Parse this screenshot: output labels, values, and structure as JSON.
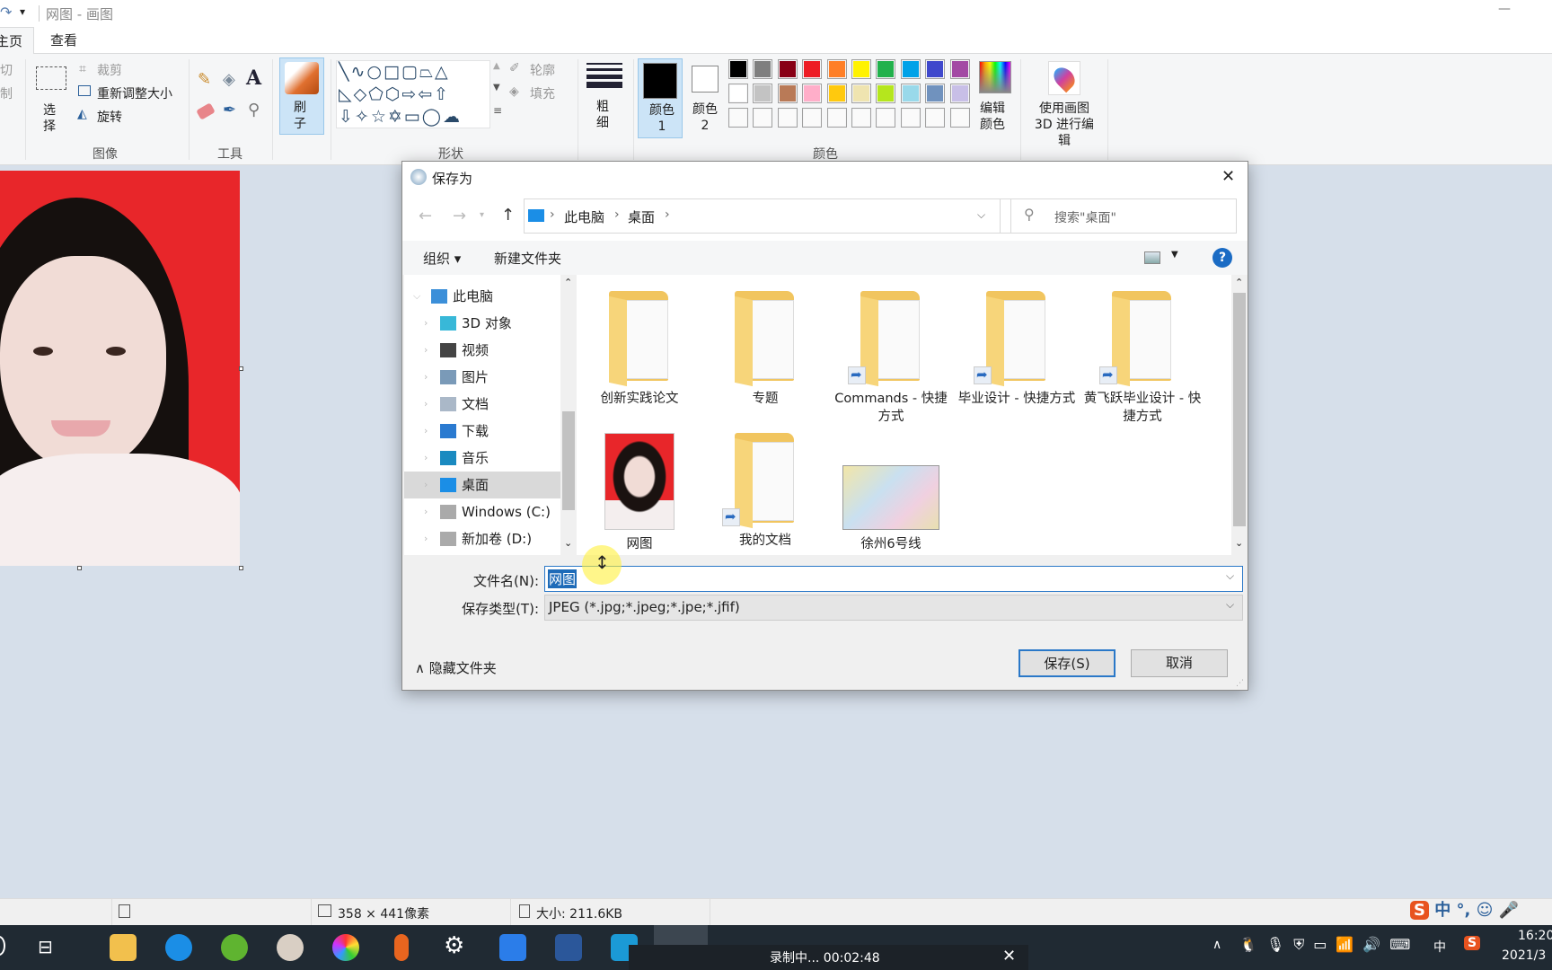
{
  "window": {
    "title": "网图 - 画图",
    "minimize_glyph": "—"
  },
  "tabs": [
    {
      "label": "主页"
    },
    {
      "label": "查看"
    }
  ],
  "ribbon": {
    "clipboard": {
      "cut": "剪切",
      "copy": "复制"
    },
    "image": {
      "label": "图像",
      "select": "选择",
      "crop": "裁剪",
      "resize": "重新调整大小",
      "rotate": "旋转"
    },
    "tools": {
      "label": "工具"
    },
    "brush": {
      "label": "刷子"
    },
    "shapes": {
      "label": "形状",
      "outline": "轮廓",
      "fill": "填充"
    },
    "size": {
      "label": "粗细"
    },
    "colors": {
      "label": "颜色",
      "color1": "颜色 1",
      "color2": "颜色 2",
      "edit": "编辑颜色",
      "palette_row1": [
        "#000000",
        "#7f7f7f",
        "#880015",
        "#ed1c24",
        "#ff7f27",
        "#fff200",
        "#22b14c",
        "#00a2e8",
        "#3f48cc",
        "#a349a4"
      ],
      "palette_row2": [
        "#ffffff",
        "#c3c3c3",
        "#b97a57",
        "#ffaec9",
        "#ffc90e",
        "#efe4b0",
        "#b5e61d",
        "#99d9ea",
        "#7092be",
        "#c8bfe7"
      ],
      "color1_value": "#000000",
      "color2_value": "#ffffff"
    },
    "paint3d": {
      "label": "使用画图 3D 进行编辑"
    }
  },
  "statusbar": {
    "dimensions": "358 × 441像素",
    "size": "大小: 211.6KB"
  },
  "dialog": {
    "title": "保存为",
    "close_glyph": "✕",
    "breadcrumb": [
      "此电脑",
      "桌面"
    ],
    "search_placeholder": "搜索\"桌面\"",
    "toolbar": {
      "organize": "组织",
      "new_folder": "新建文件夹",
      "help": "?"
    },
    "nav": [
      {
        "label": "此电脑",
        "icon": "computer-icon"
      },
      {
        "label": "3D 对象",
        "icon": "cube-icon"
      },
      {
        "label": "视频",
        "icon": "video-icon"
      },
      {
        "label": "图片",
        "icon": "pictures-icon"
      },
      {
        "label": "文档",
        "icon": "documents-icon"
      },
      {
        "label": "下载",
        "icon": "download-icon"
      },
      {
        "label": "音乐",
        "icon": "music-icon"
      },
      {
        "label": "桌面",
        "icon": "desktop-icon",
        "selected": true
      },
      {
        "label": "Windows (C:)",
        "icon": "drive-icon"
      },
      {
        "label": "新加卷 (D:)",
        "icon": "drive-icon"
      }
    ],
    "items": [
      {
        "label": "创新实践论文",
        "type": "folder"
      },
      {
        "label": "专题",
        "type": "folder"
      },
      {
        "label": "Commands - 快捷方式",
        "type": "shortcut"
      },
      {
        "label": "毕业设计 - 快捷方式",
        "type": "shortcut"
      },
      {
        "label": "黄飞跃毕业设计 - 快捷方式",
        "type": "shortcut"
      },
      {
        "label": "网图",
        "type": "image"
      },
      {
        "label": "我的文档",
        "type": "shortcut"
      },
      {
        "label": "徐州6号线",
        "type": "image"
      }
    ],
    "filename_label": "文件名(N):",
    "filename_value": "网图",
    "filetype_label": "保存类型(T):",
    "filetype_value": "JPEG (*.jpg;*.jpeg;*.jpe;*.jfif)",
    "hide_folders": "隐藏文件夹",
    "save": "保存(S)",
    "cancel": "取消"
  },
  "taskbar": {
    "recording": "录制中... 00:02:48",
    "time": "16:20",
    "date": "2021/3",
    "ime": "中"
  }
}
